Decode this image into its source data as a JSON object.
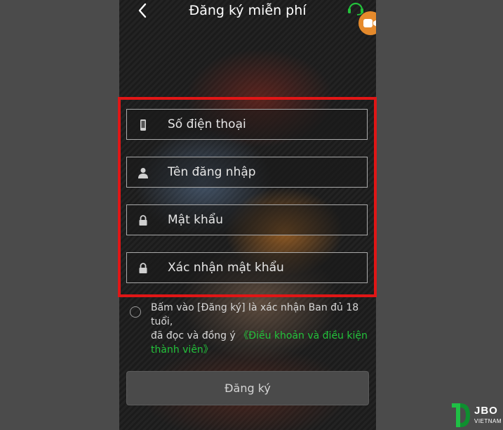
{
  "header": {
    "title": "Đăng ký miễn phí",
    "back_icon": "chevron-left-icon",
    "support_icon": "headset-icon",
    "camera_icon": "video-camera-icon"
  },
  "form": {
    "fields": [
      {
        "placeholder": "Số điện thoại",
        "value": "",
        "icon": "phone-icon"
      },
      {
        "placeholder": "Tên đăng nhập",
        "value": "",
        "icon": "user-icon"
      },
      {
        "placeholder": "Mật khẩu",
        "value": "",
        "icon": "lock-icon"
      },
      {
        "placeholder": "Xác nhận mật khẩu",
        "value": "",
        "icon": "lock-icon"
      }
    ],
    "consent_text_1": "Bấm vào [Đăng ký] là xác nhận Ban đủ 18 tuổi,",
    "consent_text_2": "đã đọc và đồng ý ",
    "consent_link": "《Điều khoản và điều kiện thành viên》",
    "submit_label": "Đăng ký"
  },
  "watermark": {
    "brand": "JBO",
    "sub": "VIETNAM"
  },
  "colors": {
    "highlight": "#e01616",
    "link": "#23c23b",
    "button": "#4a4a4a",
    "camera_badge": "#e58a2c",
    "support_icon": "#23c23b"
  }
}
